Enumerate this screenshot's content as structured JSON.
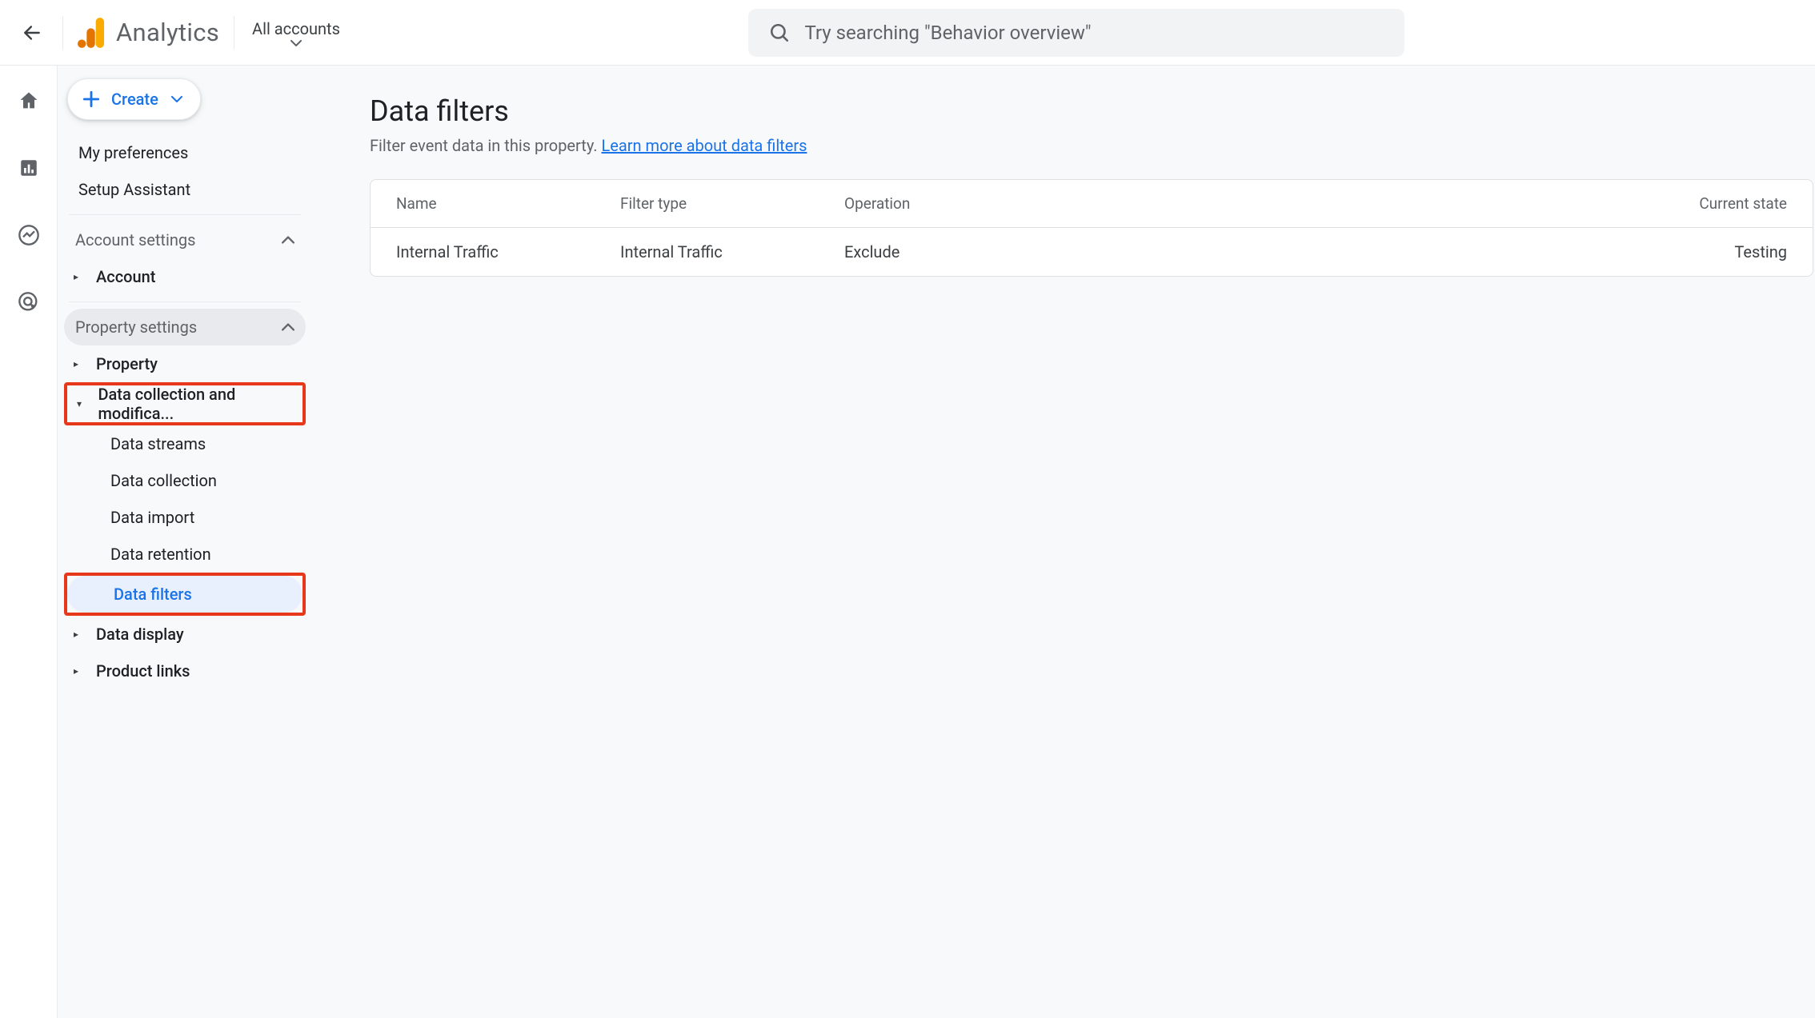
{
  "header": {
    "brand": "Analytics",
    "account_switcher": "All accounts",
    "search_placeholder": "Try searching \"Behavior overview\""
  },
  "admin": {
    "create_label": "Create",
    "my_preferences": "My preferences",
    "setup_assistant": "Setup Assistant",
    "account_settings": "Account settings",
    "account": "Account",
    "property_settings": "Property settings",
    "property": "Property",
    "data_collection_mod": "Data collection and modifica...",
    "data_streams": "Data streams",
    "data_collection": "Data collection",
    "data_import": "Data import",
    "data_retention": "Data retention",
    "data_filters": "Data filters",
    "data_display": "Data display",
    "product_links": "Product links"
  },
  "page": {
    "title": "Data filters",
    "subtitle_a": "Filter event data in this property. ",
    "subtitle_link": "Learn more about data filters"
  },
  "table": {
    "columns": {
      "name": "Name",
      "filter_type": "Filter type",
      "operation": "Operation",
      "current_state": "Current state"
    },
    "rows": [
      {
        "name": "Internal Traffic",
        "filter_type": "Internal Traffic",
        "operation": "Exclude",
        "current_state": "Testing"
      }
    ]
  }
}
